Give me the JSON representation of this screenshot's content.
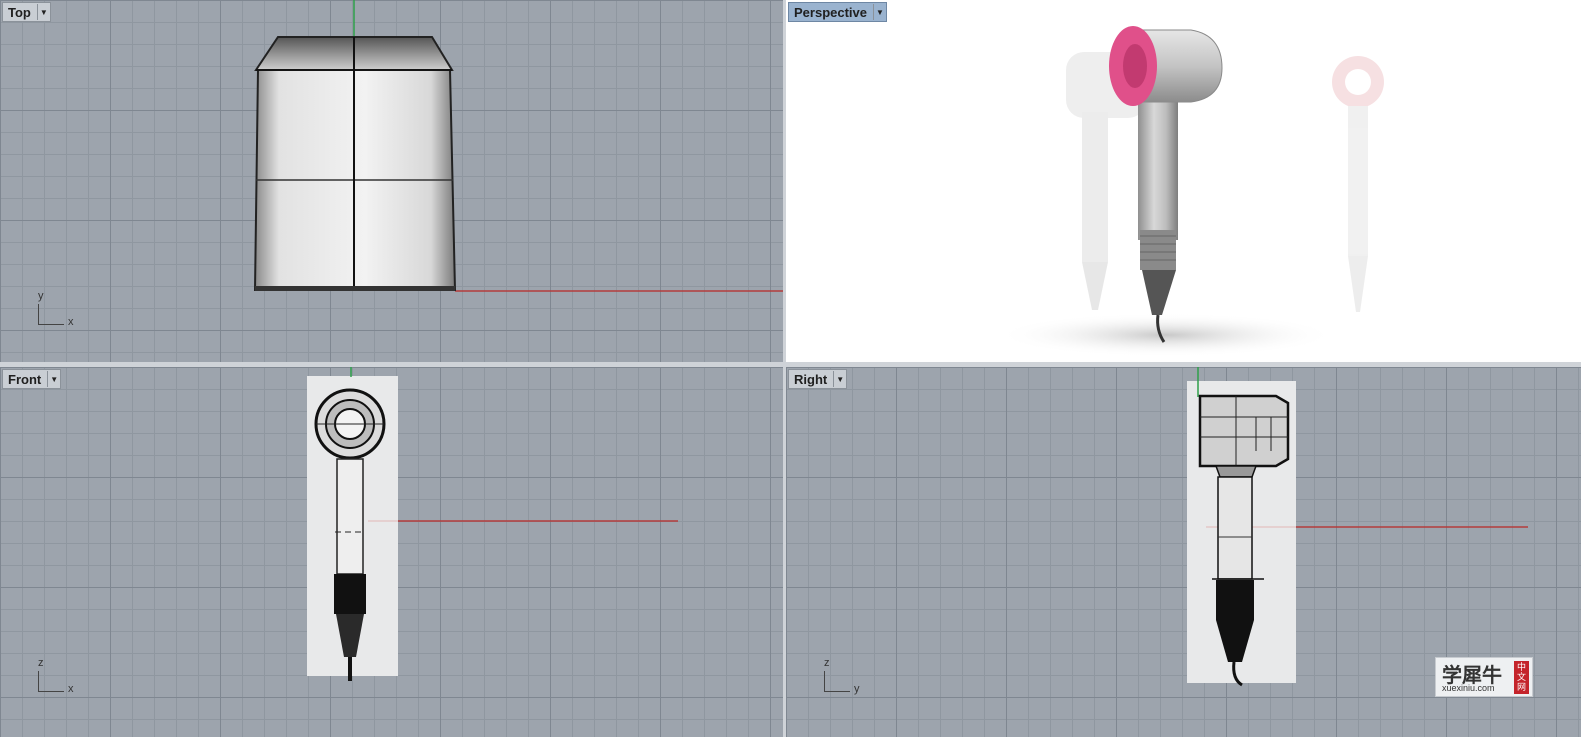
{
  "viewports": {
    "top": {
      "label": "Top",
      "axis_v": "y",
      "axis_h": "x"
    },
    "perspective": {
      "label": "Perspective"
    },
    "front": {
      "label": "Front",
      "axis_v": "z",
      "axis_h": "x"
    },
    "right": {
      "label": "Right",
      "axis_v": "z",
      "axis_h": "y"
    }
  },
  "active_viewport": "Perspective",
  "colors": {
    "grid_background": "#9da4ad",
    "x_axis": "#b43c3c",
    "y_axis": "#2fa04a",
    "nozzle_accent": "#e0508a",
    "active_tab": "#9ab3cf"
  },
  "watermark": {
    "text_zh": "学犀牛",
    "text_en": "xuexiniu.com",
    "badge": "中文网"
  }
}
